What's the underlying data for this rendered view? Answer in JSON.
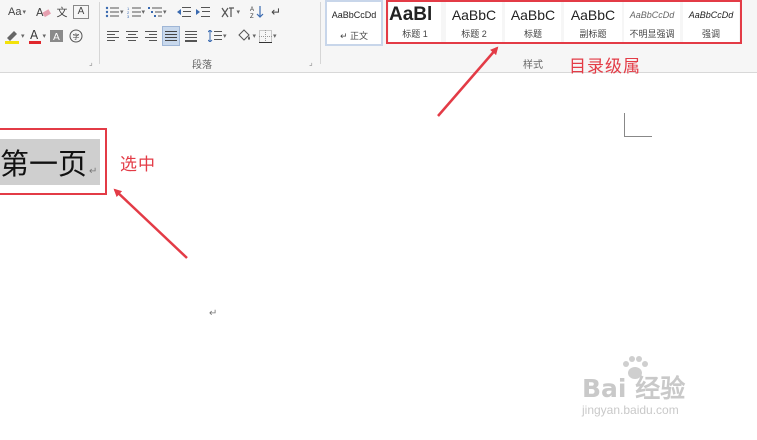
{
  "ribbon": {
    "font_group": {
      "change_case": "Aa",
      "clear_format": "A",
      "phonetic": "文",
      "char_border": "A",
      "highlight": "ab",
      "font_color": "A",
      "char_shading": "A",
      "enclose": "字"
    },
    "paragraph_group": {
      "label": "段落"
    },
    "styles_group": {
      "label": "样式",
      "items": [
        {
          "preview": "AaBbCcDd",
          "name": "正文"
        },
        {
          "preview": "AaBl",
          "name": "标题 1"
        },
        {
          "preview": "AaBbC",
          "name": "标题 2"
        },
        {
          "preview": "AaBbC",
          "name": "标题"
        },
        {
          "preview": "AaBbC",
          "name": "副标题"
        },
        {
          "preview": "AaBbCcDd",
          "name": "不明显强调"
        },
        {
          "preview": "AaBbCcDd",
          "name": "强调"
        }
      ]
    }
  },
  "annotations": {
    "styles_note": "目录级属",
    "select_note": "选中"
  },
  "document": {
    "heading_text": "第一页",
    "paragraph_mark": "↵"
  },
  "watermark": {
    "brand": "Bai  经验",
    "url": "jingyan.baidu.com"
  },
  "colors": {
    "annotation_red": "#e33b46",
    "selection_gray": "#cfcfcf",
    "ribbon_bg": "#f6f6f6"
  }
}
